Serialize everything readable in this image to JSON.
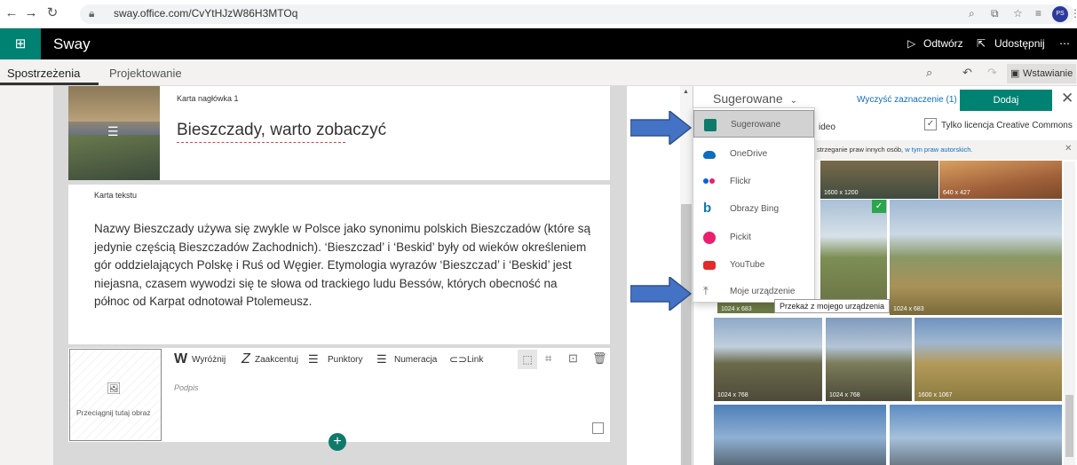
{
  "browser": {
    "url": "sway.office.com/CvYtHJzW86H3MTOq",
    "avatar_initials": "PS"
  },
  "app": {
    "title": "Sway",
    "play_label": "Odtwórz",
    "share_label": "Udostępnij",
    "more_label": "⋯"
  },
  "tabs": {
    "insights": "Spostrzeżenia",
    "design": "Projektowanie",
    "insert": "Wstawianie"
  },
  "cards": {
    "heading_card_label": "Karta nagłówka 1",
    "heading_text": "Bieszczady, warto zobaczyć",
    "text_card_label": "Karta tekstu",
    "body_text": "Nazwy Bieszczady używa się zwykle w Polsce jako synonimu polskich Bieszczadów (które są jedynie częścią Bieszczadów Zachodnich). ‘Bieszczad’ i ‘Beskid’ były od wieków określeniem gór oddzielających Polskę i Ruś od Węgier. Etymologia wyrazów ‘Bieszczad’ i ‘Beskid’ jest niejasna, czasem wywodzi się te słowa od trackiego ludu Bessów, których obecność na północ od Karpat odnotował Ptolemeusz.",
    "drop_image_label": "Przeciągnij tutaj obraz",
    "caption_placeholder": "Podpis"
  },
  "toolbar": {
    "highlight": "Wyróżnij",
    "emphasize": "Zaakcentuj",
    "bullets": "Punktory",
    "numbering": "Numeracja",
    "link": "Link"
  },
  "pane": {
    "source_selected": "Sugerowane",
    "clear_selection": "Wyczyść zaznaczenie (1)",
    "add_label": "Dodaj",
    "video_fragment": "ideo",
    "license_label": "Tylko licencja Creative Commons",
    "notice_text": "strzeganie praw innych osób, ",
    "notice_link": "w tym praw autorskich."
  },
  "sources": [
    {
      "label": "Sugerowane",
      "icon": "suggested-icon",
      "color": "#0e7a6a"
    },
    {
      "label": "OneDrive",
      "icon": "onedrive-icon",
      "color": "#0f6cbd"
    },
    {
      "label": "Flickr",
      "icon": "flickr-icon",
      "color": "#e81e7a"
    },
    {
      "label": "Obrazy Bing",
      "icon": "bing-icon",
      "color": "#0f7aa8"
    },
    {
      "label": "Pickit",
      "icon": "pickit-icon",
      "color": "#e8206e"
    },
    {
      "label": "YouTube",
      "icon": "youtube-icon",
      "color": "#e02b2b"
    },
    {
      "label": "Moje urządzenie",
      "icon": "upload-icon",
      "color": "#666666"
    }
  ],
  "tooltip": "Przekaż z mojego urządzenia",
  "photos": [
    {
      "dim": "1600 x 1200"
    },
    {
      "dim": "640 x 427"
    },
    {
      "dim": "1024 x 683"
    },
    {
      "dim": "1024 x 683"
    },
    {
      "dim": "1024 x 768"
    },
    {
      "dim": "1024 x 768"
    },
    {
      "dim": "1600 x 1067"
    }
  ]
}
